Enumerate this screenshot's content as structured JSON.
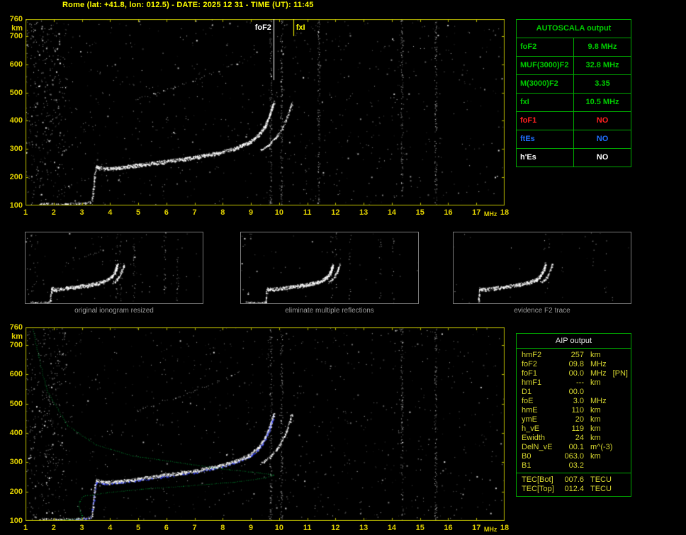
{
  "title": "Rome (lat: +41.8, lon: 012.5) - DATE: 2025 12 31 - TIME (UT): 11:45",
  "colors": {
    "axis": "#e0d000",
    "title": "#ffff00",
    "table_border": "#00aa00",
    "green": "#00cc00",
    "red": "#ff2020",
    "blue": "#2070ff",
    "white": "#ffffff",
    "caption_gray": "#9c9c9c",
    "aip_text": "#d8d830"
  },
  "autoscala_table": {
    "title": "AUTOSCALA output",
    "rows": [
      {
        "label": "foF2",
        "value": "9.8 MHz",
        "color": "#00cc00"
      },
      {
        "label": "MUF(3000)F2",
        "value": "32.8 MHz",
        "color": "#00cc00"
      },
      {
        "label": "M(3000)F2",
        "value": "3.35",
        "color": "#00cc00"
      },
      {
        "label": "fxI",
        "value": "10.5 MHz",
        "color": "#00cc00"
      },
      {
        "label": "foF1",
        "value": "NO",
        "color": "#ff2020"
      },
      {
        "label": "ftEs",
        "value": "NO",
        "color": "#2070ff"
      },
      {
        "label": "h'Es",
        "value": "NO",
        "color": "#ffffff"
      }
    ]
  },
  "thumbnails": [
    {
      "caption": "original ionogram resized"
    },
    {
      "caption": "eliminate multiple reflections"
    },
    {
      "caption": "evidence F2 trace"
    }
  ],
  "aip_table": {
    "title": "AIP output",
    "rows": [
      {
        "label": "hmF2",
        "value": "257",
        "unit": "km",
        "note": ""
      },
      {
        "label": "foF2",
        "value": "09.8",
        "unit": "MHz",
        "note": ""
      },
      {
        "label": "foF1",
        "value": "00.0",
        "unit": "MHz",
        "note": "[PN]"
      },
      {
        "label": "hmF1",
        "value": "---",
        "unit": "km",
        "note": ""
      },
      {
        "label": "D1",
        "value": "00.0",
        "unit": "",
        "note": ""
      },
      {
        "label": "foE",
        "value": "3.0",
        "unit": "MHz",
        "note": ""
      },
      {
        "label": "hmE",
        "value": "110",
        "unit": "km",
        "note": ""
      },
      {
        "label": "ymE",
        "value": "20",
        "unit": "km",
        "note": ""
      },
      {
        "label": "h_vE",
        "value": "119",
        "unit": "km",
        "note": ""
      },
      {
        "label": "Ewidth",
        "value": "24",
        "unit": "km",
        "note": ""
      },
      {
        "label": "DelN_vE",
        "value": "00.1",
        "unit": "m^(-3)",
        "note": ""
      },
      {
        "label": "B0",
        "value": "063.0",
        "unit": "km",
        "note": ""
      },
      {
        "label": "B1",
        "value": "03.2",
        "unit": "",
        "note": ""
      }
    ],
    "tec_rows": [
      {
        "label": "TEC[Bot]",
        "value": "007.6",
        "unit": "TECU"
      },
      {
        "label": "TEC[Top]",
        "value": "012.4",
        "unit": "TECU"
      }
    ]
  },
  "chart_data": [
    {
      "type": "scatter",
      "name": "autoscaled ionogram (virtual height vs frequency)",
      "xlabel": "MHz",
      "ylabel": "km",
      "xlim": [
        1,
        18
      ],
      "ylim": [
        100,
        760
      ],
      "x_ticks": [
        1,
        2,
        3,
        4,
        5,
        6,
        7,
        8,
        9,
        10,
        11,
        12,
        13,
        14,
        15,
        16,
        17,
        18
      ],
      "y_ticks": [
        760,
        700,
        600,
        500,
        400,
        300,
        200,
        100
      ],
      "grid": false,
      "markers": [
        {
          "label": "foF2",
          "f": 9.8,
          "color": "#ffffff",
          "line_to_km": 545,
          "label_side": "left"
        },
        {
          "label": "fxI",
          "f": 10.5,
          "color": "#ffff00",
          "line_to_km": 700,
          "label_side": "right"
        }
      ],
      "interference_bands": [
        9.7,
        10.08,
        11.4,
        14.35,
        15.55
      ],
      "series": [
        {
          "name": "E-trace",
          "color": "#ffffff",
          "style": "dense",
          "points": [
            [
              1.5,
              107
            ],
            [
              2.1,
              105
            ],
            [
              2.8,
              107
            ],
            [
              3.3,
              112
            ]
          ]
        },
        {
          "name": "EF-cusp",
          "color": "#ffffff",
          "style": "dense",
          "points": [
            [
              3.36,
              118
            ],
            [
              3.4,
              160
            ],
            [
              3.44,
              205
            ],
            [
              3.5,
              238
            ]
          ]
        },
        {
          "name": "F2-ordinary",
          "color": "#ffffff",
          "style": "band",
          "points": [
            [
              3.5,
              240
            ],
            [
              3.8,
              231
            ],
            [
              4.3,
              234
            ],
            [
              5.0,
              244
            ],
            [
              6.0,
              257
            ],
            [
              7.0,
              271
            ],
            [
              7.8,
              286
            ],
            [
              8.4,
              302
            ],
            [
              8.9,
              322
            ],
            [
              9.25,
              349
            ],
            [
              9.5,
              384
            ],
            [
              9.65,
              418
            ],
            [
              9.75,
              448
            ],
            [
              9.8,
              466
            ]
          ]
        },
        {
          "name": "F2-extraordinary",
          "color": "#ffffff",
          "style": "dense",
          "points": [
            [
              9.35,
              297
            ],
            [
              9.65,
              317
            ],
            [
              9.9,
              344
            ],
            [
              10.1,
              374
            ],
            [
              10.25,
              408
            ],
            [
              10.38,
              443
            ],
            [
              10.45,
              466
            ]
          ]
        },
        {
          "name": "second-hop",
          "color": "#c8c8c8",
          "style": "sparse",
          "points": [
            [
              4.9,
              478
            ],
            [
              5.6,
              498
            ],
            [
              6.3,
              520
            ],
            [
              7.0,
              545
            ],
            [
              7.6,
              568
            ],
            [
              8.2,
              592
            ],
            [
              8.6,
              612
            ]
          ]
        }
      ]
    },
    {
      "type": "scatter",
      "name": "ionogram with AIP fitted trace and electron density profile",
      "xlabel": "MHz",
      "ylabel": "km",
      "xlim": [
        1,
        18
      ],
      "ylim": [
        100,
        760
      ],
      "x_ticks": [
        1,
        2,
        3,
        4,
        5,
        6,
        7,
        8,
        9,
        10,
        11,
        12,
        13,
        14,
        15,
        16,
        17,
        18
      ],
      "y_ticks": [
        760,
        700,
        600,
        500,
        400,
        300,
        200,
        100
      ],
      "grid": false,
      "markers": [],
      "interference_bands": [
        9.7,
        10.08,
        14.35,
        15.55
      ],
      "series": [
        {
          "name": "E-trace",
          "color": "#ffffff",
          "style": "dense",
          "points": [
            [
              1.5,
              107
            ],
            [
              2.1,
              105
            ],
            [
              2.8,
              107
            ],
            [
              3.3,
              112
            ]
          ]
        },
        {
          "name": "EF-cusp",
          "color": "#ffffff",
          "style": "dense",
          "points": [
            [
              3.36,
              118
            ],
            [
              3.4,
              160
            ],
            [
              3.44,
              205
            ],
            [
              3.5,
              238
            ]
          ]
        },
        {
          "name": "F2-ordinary",
          "color": "#ffffff",
          "style": "band",
          "points": [
            [
              3.5,
              240
            ],
            [
              3.8,
              231
            ],
            [
              4.3,
              234
            ],
            [
              5.0,
              244
            ],
            [
              6.0,
              257
            ],
            [
              7.0,
              271
            ],
            [
              7.8,
              286
            ],
            [
              8.4,
              302
            ],
            [
              8.9,
              322
            ],
            [
              9.25,
              349
            ],
            [
              9.5,
              384
            ],
            [
              9.65,
              418
            ],
            [
              9.75,
              448
            ],
            [
              9.8,
              466
            ]
          ]
        },
        {
          "name": "F2-extraordinary",
          "color": "#ffffff",
          "style": "dense",
          "points": [
            [
              9.35,
              297
            ],
            [
              9.65,
              317
            ],
            [
              9.9,
              344
            ],
            [
              10.1,
              374
            ],
            [
              10.25,
              408
            ],
            [
              10.38,
              443
            ],
            [
              10.45,
              466
            ]
          ]
        },
        {
          "name": "second-hop",
          "color": "#c8c8c8",
          "style": "sparse",
          "points": [
            [
              4.9,
              478
            ],
            [
              5.6,
              498
            ],
            [
              6.3,
              520
            ],
            [
              7.0,
              545
            ],
            [
              7.6,
              568
            ],
            [
              8.2,
              592
            ],
            [
              8.6,
              612
            ]
          ]
        },
        {
          "name": "fitted-trace",
          "color": "#3040ff",
          "style": "fit",
          "points": [
            [
              2.6,
              104
            ],
            [
              3.3,
              110
            ],
            [
              3.42,
              170
            ],
            [
              3.5,
              232
            ],
            [
              3.8,
              226
            ],
            [
              4.3,
              229
            ],
            [
              5.0,
              239
            ],
            [
              6.0,
              252
            ],
            [
              7.0,
              266
            ],
            [
              7.8,
              281
            ],
            [
              8.4,
              297
            ],
            [
              8.9,
              317
            ],
            [
              9.25,
              344
            ],
            [
              9.5,
              379
            ],
            [
              9.65,
              413
            ],
            [
              9.75,
              443
            ],
            [
              9.8,
              460
            ]
          ]
        },
        {
          "name": "electron-density-profile",
          "color": "#00b840",
          "style": "dotted",
          "points": [
            [
              1.25,
              760
            ],
            [
              1.45,
              665
            ],
            [
              1.75,
              545
            ],
            [
              2.5,
              425
            ],
            [
              3.5,
              360
            ],
            [
              4.8,
              322
            ],
            [
              6.4,
              300
            ],
            [
              8.0,
              278
            ],
            [
              9.3,
              264
            ],
            [
              9.8,
              257
            ],
            [
              9.5,
              247
            ],
            [
              8.4,
              233
            ],
            [
              6.6,
              219
            ],
            [
              5.1,
              209
            ],
            [
              3.9,
              197
            ],
            [
              3.06,
              185
            ],
            [
              2.92,
              168
            ],
            [
              2.88,
              150
            ],
            [
              2.92,
              133
            ],
            [
              3.0,
              119
            ],
            [
              3.0,
              110
            ],
            [
              2.5,
              105
            ],
            [
              1.7,
              100
            ]
          ]
        }
      ]
    }
  ]
}
